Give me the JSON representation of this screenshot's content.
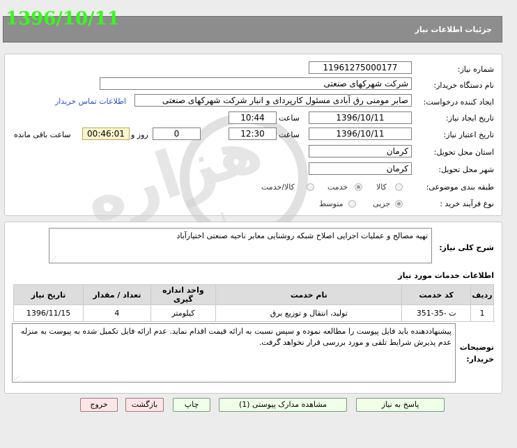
{
  "header": {
    "title": "جزئیات اطلاعات نیاز",
    "date_stamp": "1396/10/11"
  },
  "form": {
    "need_number": {
      "label": "شماره نیاز:",
      "value": "11961275000177"
    },
    "buyer_org": {
      "label": "نام دستگاه خریدار:",
      "value": "شرکت شهرکهای صنعتی"
    },
    "requester": {
      "label": "ایجاد کننده درخواست:",
      "value": "صابر مومنی رق آبادی مسئول کارپردای و انبار شرکت شهرکهای صنعتی",
      "contact_link": "اطلاعات تماس خریدار"
    },
    "created": {
      "label": "تاریخ ایجاد نیاز:",
      "date": "1396/10/11",
      "time_label": "ساعت",
      "time": "10:44"
    },
    "validity": {
      "label": "تاریخ اعتبار نیاز:",
      "date": "1396/10/11",
      "time_label": "ساعت",
      "time": "12:30",
      "days": "0",
      "days_label": "روز و",
      "remaining": "00:46:01",
      "remaining_label": "ساعت باقی مانده"
    },
    "province": {
      "label": "استان محل تحویل:",
      "value": "کرمان"
    },
    "city": {
      "label": "شهر محل تحویل:",
      "value": "کرمان"
    },
    "category": {
      "label": "طبقه بندی موضوعی:",
      "options": [
        "کالا",
        "خدمت",
        "کالا/خدمت"
      ],
      "selected": "خدمت"
    },
    "process": {
      "label": "نوع فرآیند خرید :",
      "options": [
        "جزیی",
        "متوسط"
      ],
      "selected": "جزیی"
    }
  },
  "summary": {
    "label": "شرح کلی نیاز:",
    "text": "تهیه مصالح و عملیات اجرایی اصلاح شبکه روشنایی معابر ناحیه صنعتی اختیارآباد"
  },
  "services": {
    "title": "اطلاعات خدمات مورد نیاز",
    "columns": [
      "ردیف",
      "کد خدمت",
      "نام خدمت",
      "واحد اندازه گیری",
      "تعداد / مقدار",
      "تاریخ نیاز"
    ],
    "rows": [
      [
        "1",
        "ت -35-351",
        "تولید، انتقال و توزیع برق",
        "کیلومتر",
        "4",
        "1396/11/15"
      ]
    ]
  },
  "buyer_notes": {
    "label_line1": "توضیحات",
    "label_line2": "خریدار:",
    "text": "پیشنهاددهنده باید فایل پیوست را مطالعه نموده و سپس نسبت به ارائه قیمت اقدام نماید. عدم ارائه فایل تکمیل شده به پیوست به منزله عدم پذیرش شرایط تلقی و مورد بررسی قرار نخواهد گرفت."
  },
  "buttons": {
    "reply": "پاسخ به نیاز",
    "attachments": "مشاهده مدارک پیوستی (1)",
    "print": "چاپ",
    "back": "بازگشت",
    "exit": "خروج"
  },
  "watermark": {
    "main": "هزاره",
    "sub": "ارتباط گستران"
  },
  "colors": {
    "header_bg": "#8d8d8d",
    "date_stamp": "#36ff1a",
    "link": "#2850c8",
    "button_green": "#efffe8",
    "button_pink": "#ffe6e6"
  }
}
